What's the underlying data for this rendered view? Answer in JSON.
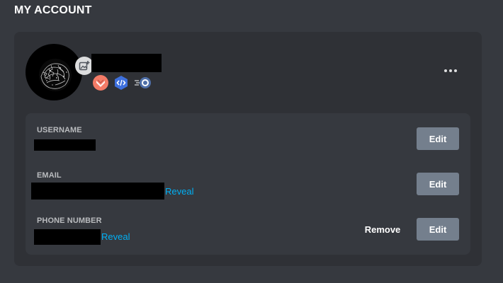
{
  "section_title": "MY ACCOUNT",
  "profile": {
    "badges": [
      "hypesquad-bravery-badge",
      "early-verified-bot-developer-badge",
      "nitro-boost-badge"
    ],
    "more_icon": "more-options-icon"
  },
  "fields": {
    "username": {
      "label": "USERNAME",
      "edit_label": "Edit"
    },
    "email": {
      "label": "EMAIL",
      "reveal_label": "Reveal",
      "edit_label": "Edit"
    },
    "phone": {
      "label": "PHONE NUMBER",
      "reveal_label": "Reveal",
      "remove_label": "Remove",
      "edit_label": "Edit"
    }
  },
  "colors": {
    "background": "#36393f",
    "card": "#2f3136",
    "link": "#00aff4",
    "button": "#747f8d",
    "badge_hypesquad": "#f47b67",
    "badge_dev": "#3e70dd"
  }
}
